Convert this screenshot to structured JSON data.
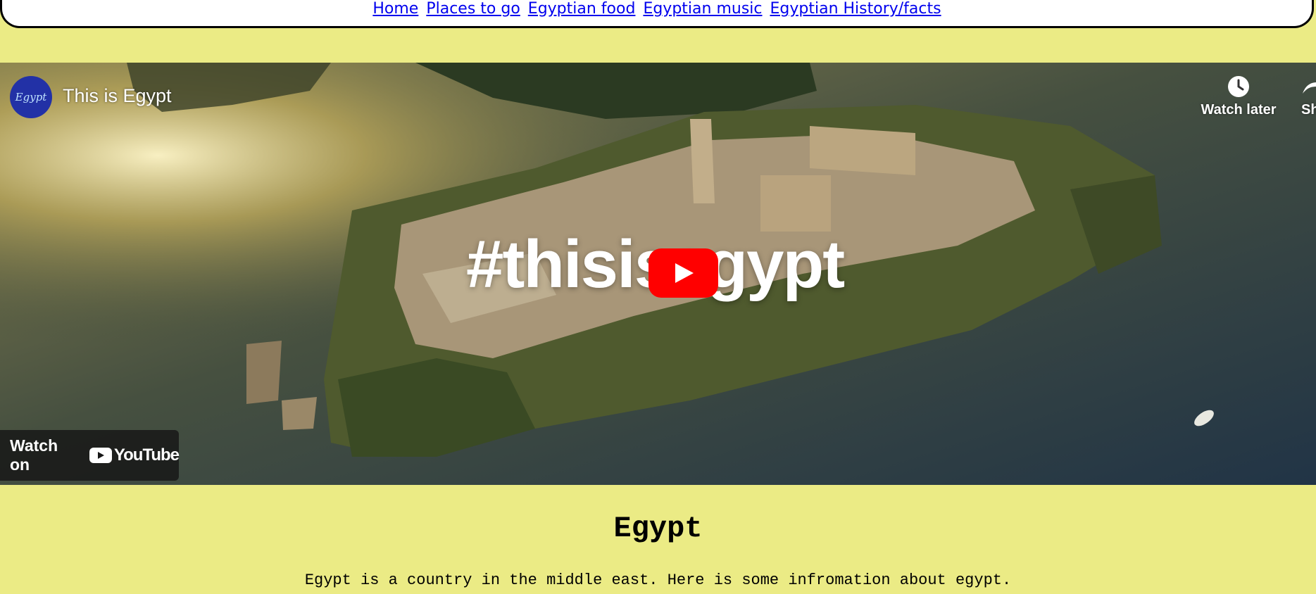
{
  "nav": {
    "links": [
      "Home",
      "Places to go",
      "Egyptian food",
      "Egyptian music",
      "Egyptian History/facts"
    ]
  },
  "video": {
    "channel_avatar_text": "Egypt",
    "title": "This is Egypt",
    "watch_later_label": "Watch later",
    "share_label": "Sh",
    "overlay_text": "#thisisegypt",
    "watch_on_label": "Watch on",
    "youtube_label": "YouTube",
    "icons": [
      "clock-icon",
      "share-icon",
      "play-icon",
      "youtube-logo-icon"
    ]
  },
  "page": {
    "heading": "Egypt",
    "intro": "Egypt is a country in the middle east. Here is some infromation about egypt."
  },
  "colors": {
    "background": "#ebeb85",
    "nav_background": "#ffffff",
    "link": "#0000ee",
    "play_button": "#ff0000"
  }
}
